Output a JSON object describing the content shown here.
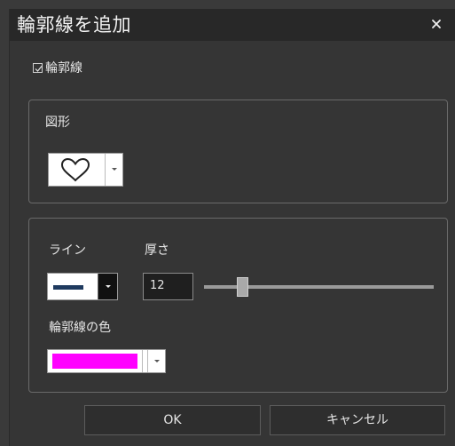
{
  "dialog": {
    "title": "輪郭線を追加",
    "close_glyph": "×"
  },
  "outline_toggle": {
    "label": "輪郭線",
    "checked": true
  },
  "shape_group": {
    "label": "図形",
    "selected_shape": "heart-icon"
  },
  "line_group": {
    "line_label": "ライン",
    "thickness_label": "厚さ",
    "thickness_value": "12",
    "slider_position": 0.15,
    "color_label": "輪郭線の色",
    "color_value": "#ff00ff",
    "line_color": "#1f3a5f"
  },
  "buttons": {
    "ok": "OK",
    "cancel": "キャンセル"
  }
}
